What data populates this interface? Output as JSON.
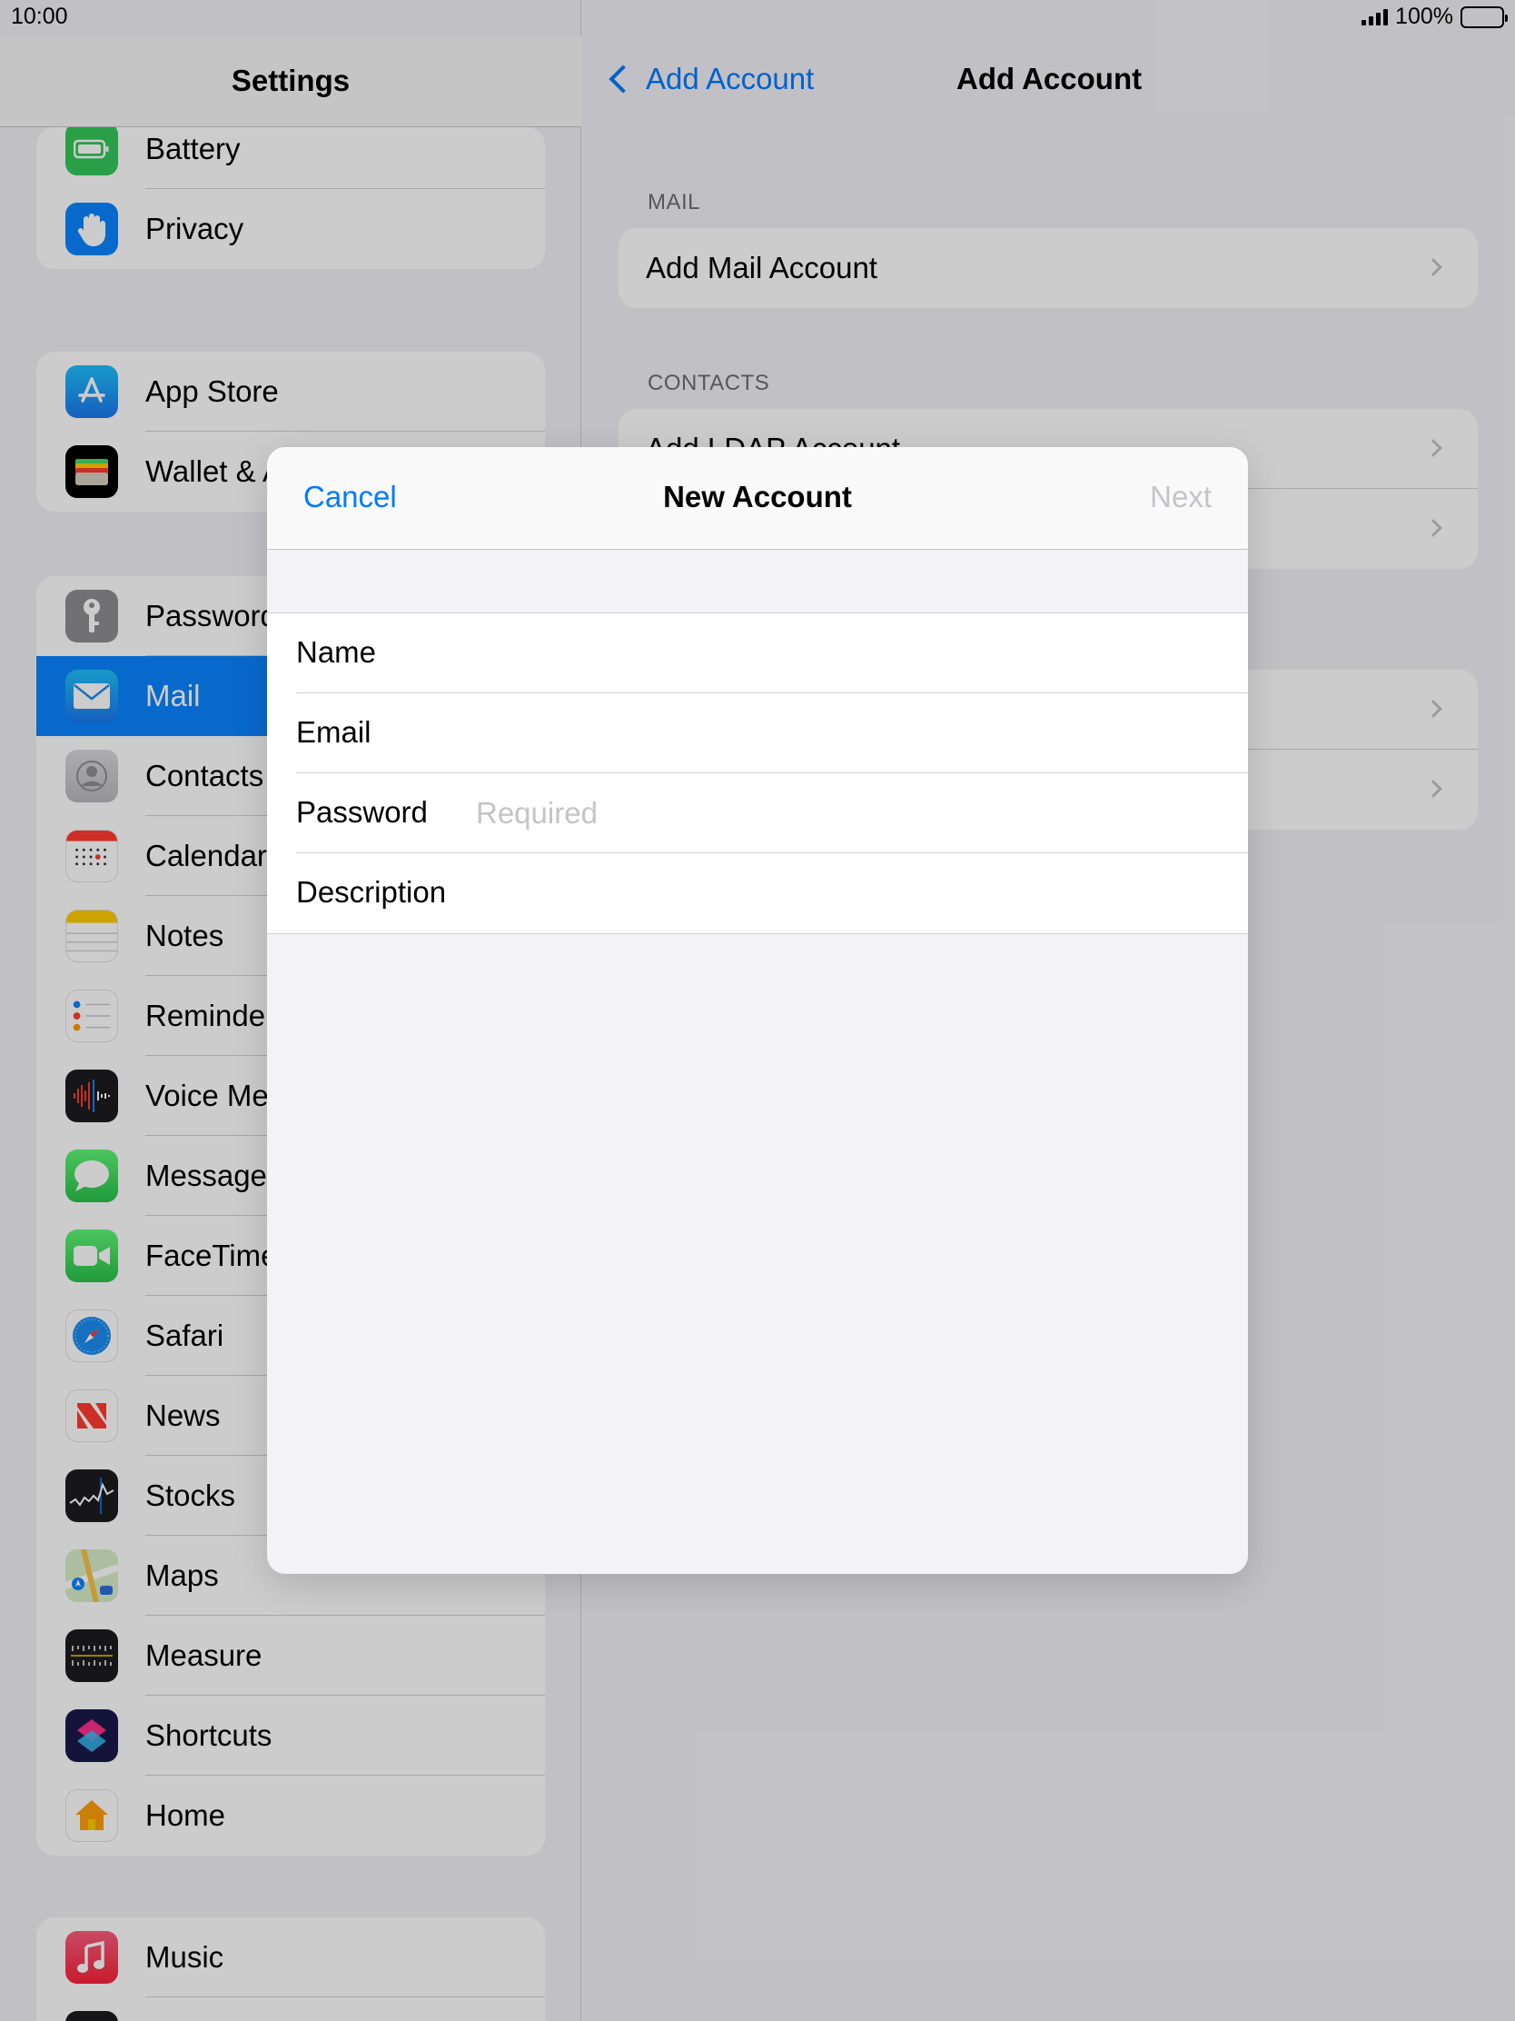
{
  "status_bar": {
    "time": "10:00",
    "battery_percent": "100%"
  },
  "sidebar": {
    "title": "Settings",
    "groups": [
      {
        "items": [
          {
            "label": "Battery",
            "icon": "battery-icon",
            "color": "#34c759"
          },
          {
            "label": "Privacy",
            "icon": "hand-icon",
            "color": "#0a84ff"
          }
        ]
      },
      {
        "items": [
          {
            "label": "App Store",
            "icon": "app-store-icon",
            "color": "#1c8cf0"
          },
          {
            "label": "Wallet & Apple Pay",
            "icon": "wallet-icon",
            "color": "#000000"
          }
        ]
      },
      {
        "items": [
          {
            "label": "Passwords",
            "icon": "key-icon",
            "color": "#8e8e93"
          },
          {
            "label": "Mail",
            "icon": "envelope-icon",
            "color": "#1e90ff",
            "selected": true
          },
          {
            "label": "Contacts",
            "icon": "contacts-icon",
            "color": "#a8a8ad"
          },
          {
            "label": "Calendar",
            "icon": "calendar-icon",
            "color": "#ffffff"
          },
          {
            "label": "Notes",
            "icon": "notes-icon",
            "color": "#ffcc00"
          },
          {
            "label": "Reminders",
            "icon": "reminders-icon",
            "color": "#ffffff"
          },
          {
            "label": "Voice Memos",
            "icon": "waveform-icon",
            "color": "#1c1c1e"
          },
          {
            "label": "Messages",
            "icon": "speech-bubble-icon",
            "color": "#34c759"
          },
          {
            "label": "FaceTime",
            "icon": "video-camera-icon",
            "color": "#34c759"
          },
          {
            "label": "Safari",
            "icon": "compass-icon",
            "color": "#ffffff"
          },
          {
            "label": "News",
            "icon": "news-icon",
            "color": "#ffffff"
          },
          {
            "label": "Stocks",
            "icon": "stocks-chart-icon",
            "color": "#1c1c1e"
          },
          {
            "label": "Maps",
            "icon": "map-icon",
            "color": "#7fd16a"
          },
          {
            "label": "Measure",
            "icon": "ruler-icon",
            "color": "#1c1c1e"
          },
          {
            "label": "Shortcuts",
            "icon": "shortcuts-icon",
            "color": "#3a3a8c"
          },
          {
            "label": "Home",
            "icon": "house-icon",
            "color": "#ffffff"
          }
        ]
      },
      {
        "items": [
          {
            "label": "Music",
            "icon": "music-note-icon",
            "color": "#fc3c44"
          }
        ]
      }
    ]
  },
  "detail": {
    "back_label": "Add Account",
    "title": "Add Account",
    "sections": [
      {
        "header": "MAIL",
        "rows": [
          "Add Mail Account"
        ]
      },
      {
        "header": "CONTACTS",
        "rows": [
          "Add LDAP Account",
          ""
        ]
      },
      {
        "header": "",
        "rows": [
          "",
          ""
        ]
      }
    ]
  },
  "modal": {
    "cancel_label": "Cancel",
    "title": "New Account",
    "next_label": "Next",
    "fields": [
      {
        "label": "Name",
        "value": "",
        "placeholder": ""
      },
      {
        "label": "Email",
        "value": "",
        "placeholder": ""
      },
      {
        "label": "Password",
        "value": "",
        "placeholder": "Required"
      },
      {
        "label": "Description",
        "value": "",
        "placeholder": ""
      }
    ]
  }
}
